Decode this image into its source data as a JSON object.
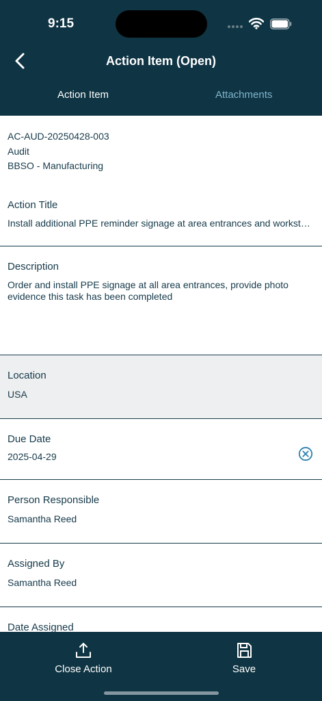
{
  "status_bar": {
    "time": "9:15"
  },
  "header": {
    "title": "Action Item (Open)"
  },
  "tabs": [
    {
      "label": "Action Item",
      "active": true
    },
    {
      "label": "Attachments",
      "active": false
    }
  ],
  "summary": {
    "id": "AC-AUD-20250428-003",
    "source": "Audit",
    "area": "BBSO - Manufacturing"
  },
  "fields": {
    "action_title": {
      "label": "Action Title",
      "value": "Install additional PPE reminder signage at area entrances and workstations"
    },
    "description": {
      "label": "Description",
      "value": "Order and install PPE signage at all area entrances, provide photo evidence this task has been completed"
    },
    "location": {
      "label": "Location",
      "value": "USA"
    },
    "due_date": {
      "label": "Due Date",
      "value": "2025-04-29"
    },
    "person_responsible": {
      "label": "Person Responsible",
      "value": "Samantha Reed"
    },
    "assigned_by": {
      "label": "Assigned By",
      "value": "Samantha Reed"
    },
    "date_assigned": {
      "label": "Date Assigned"
    }
  },
  "toolbar": {
    "close_label": "Close Action",
    "save_label": "Save"
  },
  "colors": {
    "header_bg": "#0f3443",
    "text": "#163a4a",
    "accent": "#2a7fae",
    "inactive_tab": "#7fb5cf",
    "disabled_bg": "#eeeff0"
  },
  "icons": [
    "back-chevron-icon",
    "wifi-icon",
    "battery-icon",
    "clear-circle-icon",
    "upload-icon",
    "save-disk-icon"
  ]
}
